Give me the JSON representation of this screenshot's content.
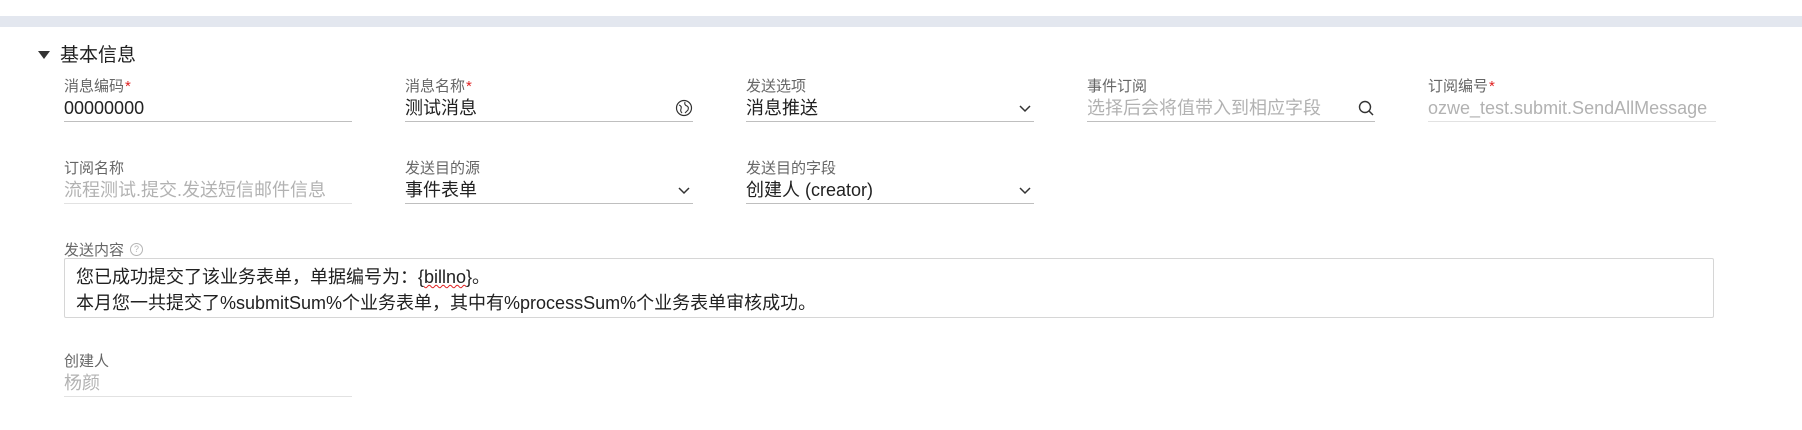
{
  "section": {
    "title": "基本信息"
  },
  "fields": {
    "msg_code": {
      "label": "消息编码",
      "value": "00000000"
    },
    "msg_name": {
      "label": "消息名称",
      "value": "测试消息"
    },
    "send_option": {
      "label": "发送选项",
      "value": "消息推送"
    },
    "event_sub": {
      "label": "事件订阅",
      "placeholder": "选择后会将值带入到相应字段"
    },
    "sub_code": {
      "label": "订阅编号",
      "value": "ozwe_test.submit.SendAllMessage"
    },
    "sub_name": {
      "label": "订阅名称",
      "value": "流程测试.提交.发送短信邮件信息"
    },
    "target_source": {
      "label": "发送目的源",
      "value": "事件表单"
    },
    "target_field": {
      "label": "发送目的字段",
      "value": "创建人 (creator)"
    },
    "creator": {
      "label": "创建人",
      "value": "杨颜"
    }
  },
  "content": {
    "label": "发送内容",
    "help": "?",
    "line1_prefix": "您已成功提交了该业务表单，单据编号为：{",
    "line1_token": "billno",
    "line1_suffix": "}。",
    "line2": "本月您一共提交了%submitSum%个业务表单，其中有%processSum%个业务表单审核成功。"
  },
  "required_mark": "*",
  "icons": [
    "caret-down-icon",
    "globe-icon",
    "chevron-down-icon",
    "search-icon",
    "help-icon"
  ]
}
